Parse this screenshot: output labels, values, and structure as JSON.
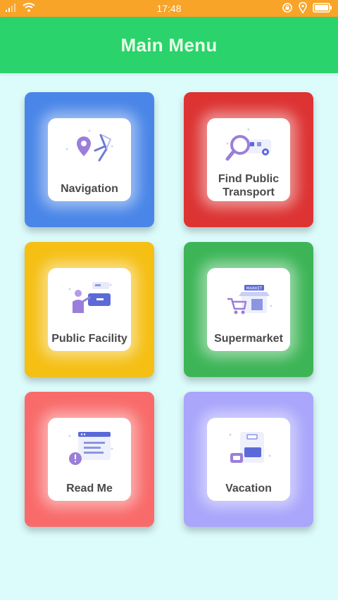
{
  "status_bar": {
    "time": "17:48",
    "battery_icon": "battery-icon",
    "colors": {
      "background": "#f7a428"
    }
  },
  "header": {
    "title": "Main Menu",
    "color": "#2ad36b"
  },
  "menu": {
    "items": [
      {
        "label": "Navigation",
        "icon": "navigation-icon",
        "color": "#4a86e8"
      },
      {
        "label": "Find Public Transport",
        "line1": "Find Public",
        "line2": "Transport",
        "icon": "find-transport-icon",
        "color": "#dd3333"
      },
      {
        "label": "Public Facility",
        "icon": "public-facility-icon",
        "color": "#f5bf14"
      },
      {
        "label": "Supermarket",
        "icon": "supermarket-icon",
        "color": "#3db557"
      },
      {
        "label": "Read Me",
        "icon": "read-me-icon",
        "color": "#f96b6b"
      },
      {
        "label": "Vacation",
        "icon": "vacation-icon",
        "color": "#a9a6fb"
      }
    ]
  }
}
